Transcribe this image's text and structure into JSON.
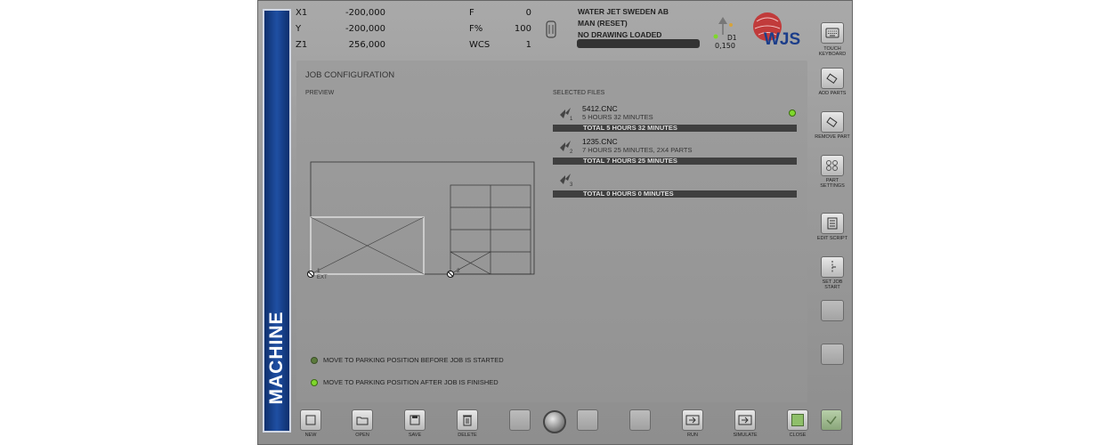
{
  "sidebar": {
    "label": "MACHINE"
  },
  "axes": [
    {
      "label": "X1",
      "value": "-200,000"
    },
    {
      "label": "Y",
      "value": "-200,000"
    },
    {
      "label": "Z1",
      "value": "256,000"
    }
  ],
  "params": [
    {
      "label": "F",
      "value": "0"
    },
    {
      "label": "F%",
      "value": "100"
    },
    {
      "label": "WCS",
      "value": "1"
    }
  ],
  "status": {
    "company": "WATER JET SWEDEN AB",
    "mode": "MAN (RESET)",
    "drawing": "NO DRAWING LOADED"
  },
  "head": {
    "name": "D1",
    "value": "0,150"
  },
  "logo": {
    "text": "WJS"
  },
  "job": {
    "title": "JOB CONFIGURATION",
    "preview_label": "PREVIEW",
    "files_label": "SELECTED FILES",
    "files": [
      {
        "index": "1",
        "name": "5412.CNC",
        "info": "5 HOURS 32 MINUTES",
        "total": "TOTAL 5 HOURS 32 MINUTES",
        "active": true
      },
      {
        "index": "2",
        "name": "1235.CNC",
        "info": "7 HOURS 25 MINUTES, 2X4 PARTS",
        "total": "TOTAL 7 HOURS 25 MINUTES",
        "active": false
      },
      {
        "index": "3",
        "name": "",
        "info": "",
        "total": "TOTAL 0 HOURS 0 MINUTES",
        "active": false
      }
    ],
    "preview": {
      "origin1": "1",
      "origin1_sub": "EXT",
      "origin2": "2"
    },
    "options": [
      {
        "text": "MOVE TO PARKING POSITION BEFORE JOB IS STARTED",
        "active": false
      },
      {
        "text": "MOVE TO PARKING POSITION AFTER JOB IS FINISHED",
        "active": true
      }
    ]
  },
  "right_buttons": [
    {
      "label_1": "TOUCH",
      "label_2": "KEYBOARD",
      "icon": "keyboard-icon"
    },
    {
      "label_1": "ADD PARTS",
      "label_2": "",
      "icon": "add-part-icon"
    },
    {
      "label_1": "REMOVE PART",
      "label_2": "",
      "icon": "remove-part-icon"
    },
    {
      "label_1": "PART",
      "label_2": "SETTINGS",
      "icon": "part-settings-icon"
    },
    {
      "label_1": "EDIT SCRIPT",
      "label_2": "",
      "icon": "script-icon"
    },
    {
      "label_1": "SET JOB",
      "label_2": "START",
      "icon": "job-start-icon"
    }
  ],
  "bottom_buttons": {
    "new": "NEW",
    "open": "OPEN",
    "save": "SAVE",
    "delete": "DELETE",
    "run": "RUN",
    "simulate": "SIMULATE",
    "close": "CLOSE"
  },
  "colors": {
    "sidebar": "#1f4fa3",
    "led_active": "#7fd82c",
    "led_inactive": "#5b7a3c",
    "logo_red": "#c62828",
    "logo_blue": "#1b3d8a"
  }
}
